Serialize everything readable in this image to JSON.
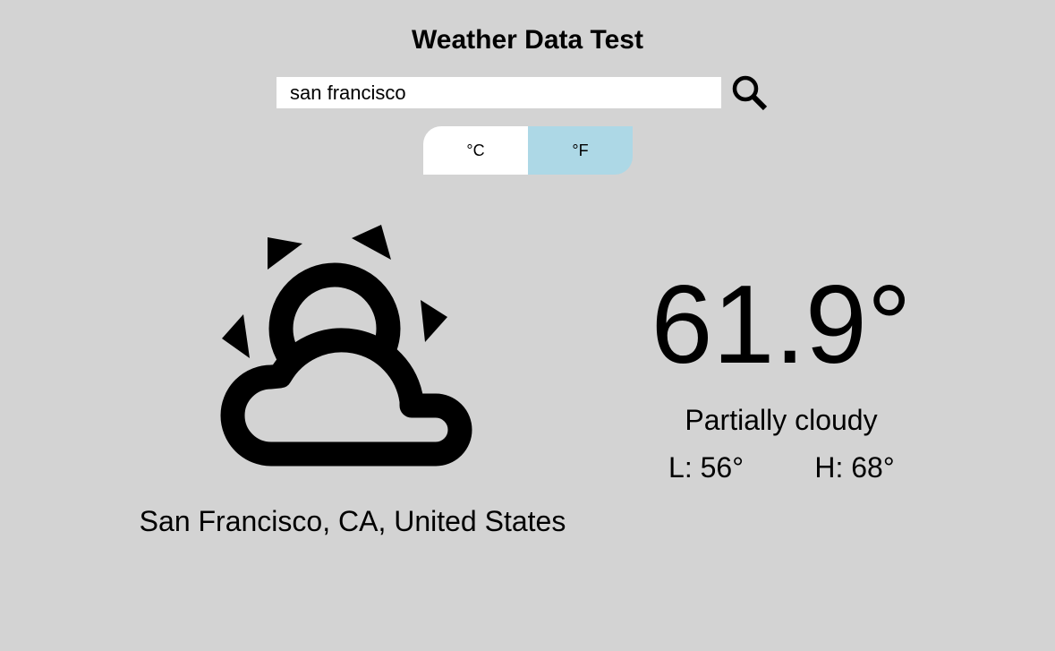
{
  "header": {
    "title": "Weather Data Test"
  },
  "search": {
    "value": "san francisco",
    "button_icon": "search-icon"
  },
  "units": {
    "celsius_label": "°C",
    "fahrenheit_label": "°F",
    "selected": "°F",
    "selected_color": "#add8e6"
  },
  "weather": {
    "icon": "partly-cloudy-icon",
    "location": "San Francisco, CA, United States",
    "temperature": "61.9°",
    "condition": "Partially cloudy",
    "low": "L: 56°",
    "high": "H: 68°"
  },
  "colors": {
    "background": "#d3d3d3",
    "input_background": "#ffffff"
  }
}
